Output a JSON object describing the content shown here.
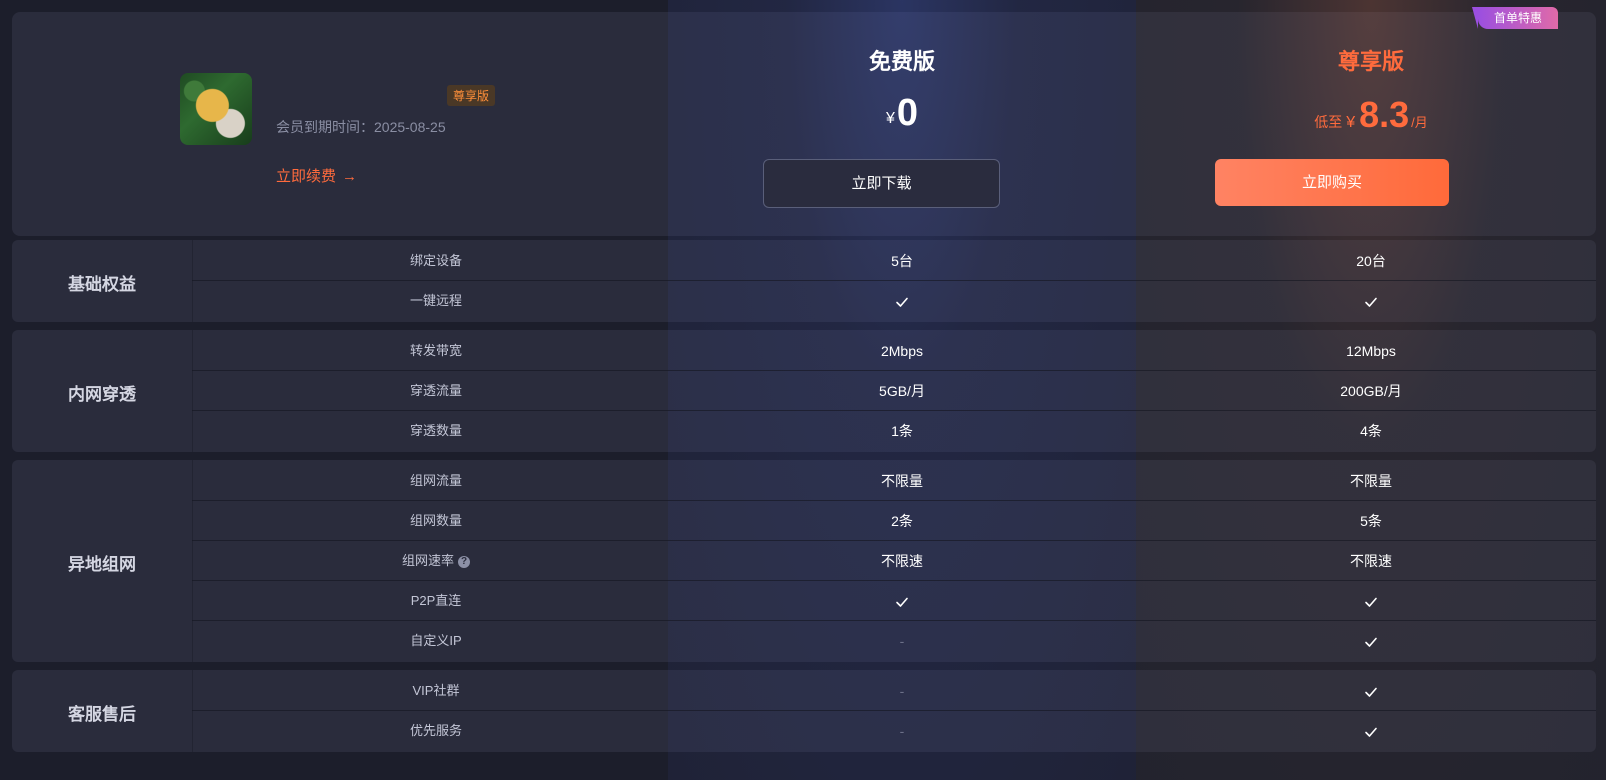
{
  "user": {
    "badge": "尊享版",
    "expire_label": "会员到期时间：",
    "expire_date": "2025-08-25",
    "renew_label": "立即续费",
    "renew_arrow": "→"
  },
  "plans": {
    "free": {
      "title": "免费版",
      "currency": "¥",
      "price": "0",
      "button": "立即下载"
    },
    "vip": {
      "title": "尊享版",
      "price_prefix": "低至",
      "currency": "¥",
      "price": "8.3",
      "unit": "/月",
      "button": "立即购买",
      "corner_badge": "首单特惠"
    }
  },
  "groups": [
    {
      "label": "基础权益",
      "rows": [
        {
          "name": "绑定设备",
          "free": "5台",
          "vip": "20台"
        },
        {
          "name": "一键远程",
          "free": "check",
          "vip": "check"
        }
      ]
    },
    {
      "label": "内网穿透",
      "rows": [
        {
          "name": "转发带宽",
          "free": "2Mbps",
          "vip": "12Mbps"
        },
        {
          "name": "穿透流量",
          "free": "5GB/月",
          "vip": "200GB/月"
        },
        {
          "name": "穿透数量",
          "free": "1条",
          "vip": "4条"
        }
      ]
    },
    {
      "label": "异地组网",
      "rows": [
        {
          "name": "组网流量",
          "free": "不限量",
          "vip": "不限量"
        },
        {
          "name": "组网数量",
          "free": "2条",
          "vip": "5条"
        },
        {
          "name": "组网速率",
          "help": "?",
          "free": "不限速",
          "vip": "不限速"
        },
        {
          "name": "P2P直连",
          "free": "check",
          "vip": "check"
        },
        {
          "name": "自定义IP",
          "free": "-",
          "vip": "check"
        }
      ]
    },
    {
      "label": "客服售后",
      "rows": [
        {
          "name": "VIP社群",
          "free": "-",
          "vip": "check"
        },
        {
          "name": "优先服务",
          "free": "-",
          "vip": "check"
        }
      ]
    }
  ]
}
